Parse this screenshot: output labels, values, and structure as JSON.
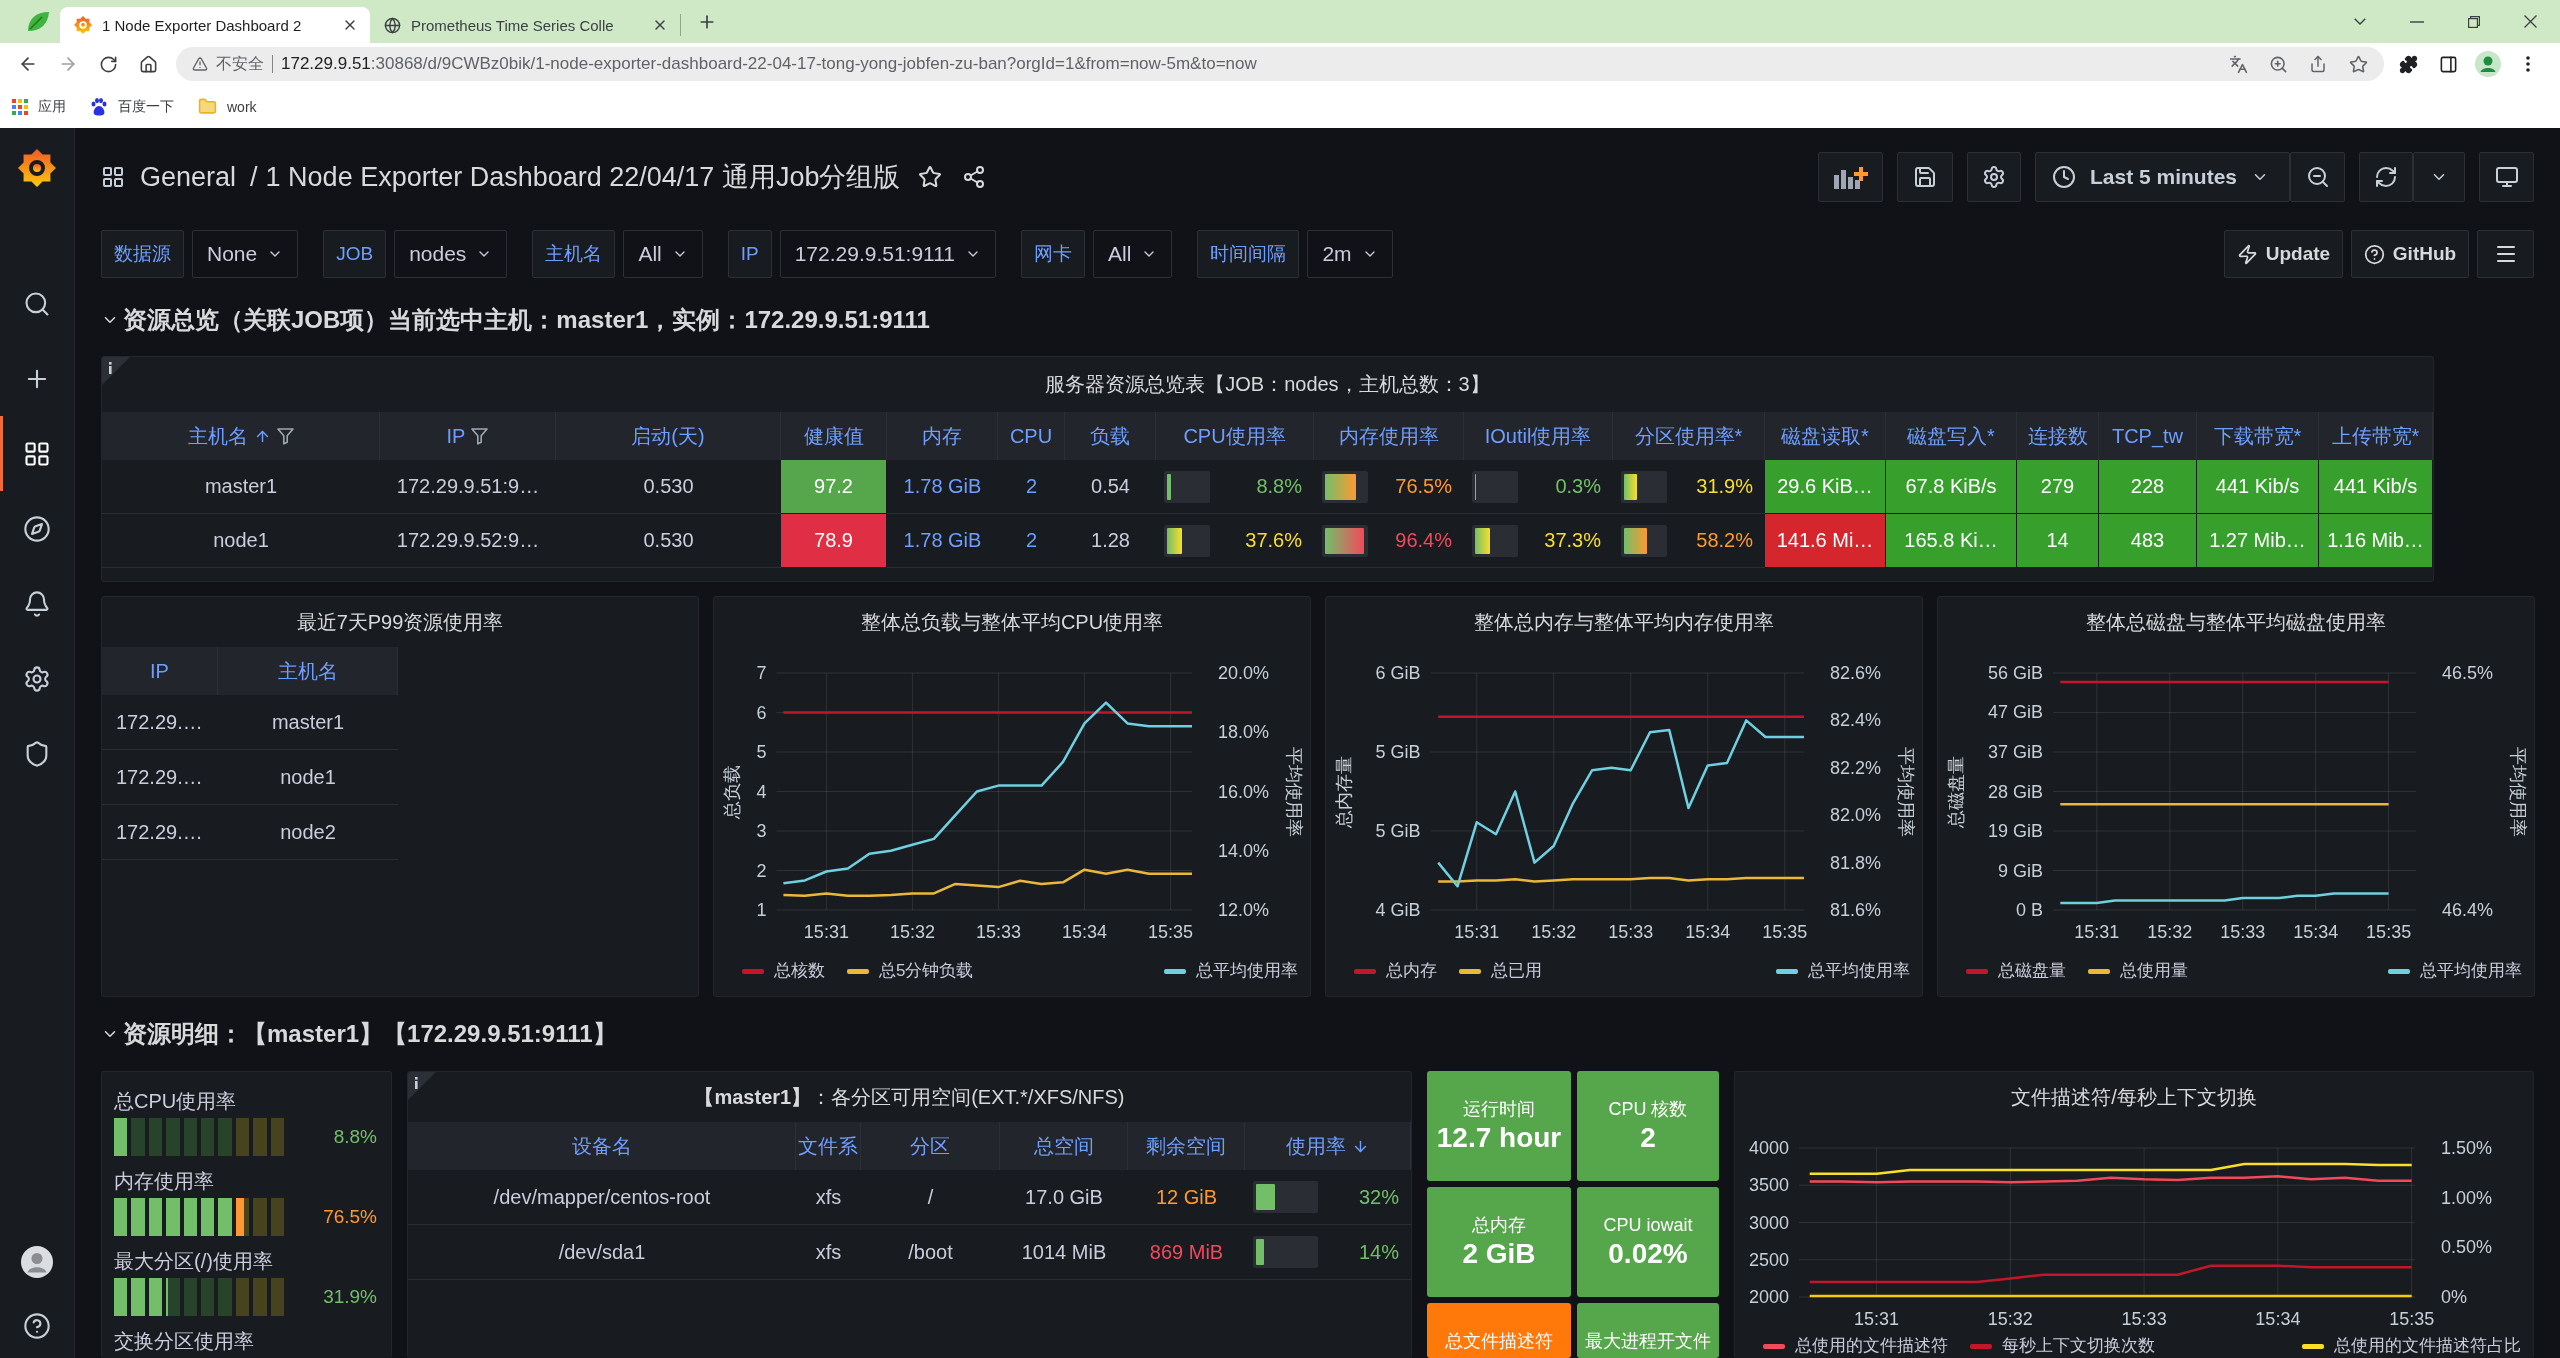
{
  "browser": {
    "tabs": [
      {
        "title": "1 Node Exporter Dashboard 2",
        "selected": true
      },
      {
        "title": "Prometheus Time Series Colle",
        "selected": false
      }
    ],
    "address": {
      "security": "不安全",
      "host": "172.29.9.51",
      "path": ":30868/d/9CWBz0bik/1-node-exporter-dashboard-22-04-17-tong-yong-jobfen-zu-ban?orgId=1&from=now-5m&to=now"
    },
    "bookmarks": [
      "应用",
      "百度一下",
      "work"
    ]
  },
  "sidebar": {
    "items": [
      {
        "selected": false
      },
      {
        "selected": false
      },
      {
        "selected": true
      },
      {
        "selected": false
      },
      {
        "selected": false
      },
      {
        "selected": false
      },
      {
        "selected": false
      }
    ]
  },
  "header": {
    "folder": "General",
    "separator": "/",
    "title": "1 Node Exporter Dashboard 22/04/17 通用Job分组版",
    "time_range": "Last 5 minutes"
  },
  "variables": [
    {
      "label": "数据源",
      "value": "None"
    },
    {
      "label": "JOB",
      "value": "nodes"
    },
    {
      "label": "主机名",
      "value": "All"
    },
    {
      "label": "IP",
      "value": "172.29.9.51:9111"
    },
    {
      "label": "网卡",
      "value": "All"
    },
    {
      "label": "时间间隔",
      "value": "2m"
    }
  ],
  "dashboard_links": [
    "Update",
    "GitHub"
  ],
  "overview_row": {
    "title": "资源总览（关联JOB项）当前选中主机：master1，实例：172.29.9.51:9111",
    "expanded": true
  },
  "server_table": {
    "title": "服务器资源总览表【JOB：nodes，主机总数：3】",
    "columns": [
      {
        "label": "主机名",
        "sorted_up": true,
        "sorted_down": false,
        "filterable": true
      },
      {
        "label": "IP",
        "sorted_up": false,
        "sorted_down": false,
        "filterable": true
      },
      {
        "label": "启动(天)",
        "sorted_up": false,
        "sorted_down": false,
        "filterable": false
      },
      {
        "label": "健康值",
        "sorted_up": false,
        "sorted_down": false,
        "filterable": false
      },
      {
        "label": "内存",
        "sorted_up": false,
        "sorted_down": false,
        "filterable": false
      },
      {
        "label": "CPU",
        "sorted_up": false,
        "sorted_down": false,
        "filterable": false
      },
      {
        "label": "负载",
        "sorted_up": false,
        "sorted_down": false,
        "filterable": false
      },
      {
        "label": "CPU使用率",
        "sorted_up": false,
        "sorted_down": false,
        "filterable": false
      },
      {
        "label": "内存使用率",
        "sorted_up": false,
        "sorted_down": false,
        "filterable": false
      },
      {
        "label": "IOutil使用率",
        "sorted_up": false,
        "sorted_down": false,
        "filterable": false
      },
      {
        "label": "分区使用率*",
        "sorted_up": false,
        "sorted_down": false,
        "filterable": false
      },
      {
        "label": "磁盘读取*",
        "sorted_up": false,
        "sorted_down": false,
        "filterable": false
      },
      {
        "label": "磁盘写入*",
        "sorted_up": false,
        "sorted_down": false,
        "filterable": false
      },
      {
        "label": "连接数",
        "sorted_up": false,
        "sorted_down": false,
        "filterable": false
      },
      {
        "label": "TCP_tw",
        "sorted_up": false,
        "sorted_down": false,
        "filterable": false
      },
      {
        "label": "下载带宽*",
        "sorted_up": false,
        "sorted_down": false,
        "filterable": false
      },
      {
        "label": "上传带宽*",
        "sorted_up": false,
        "sorted_down": false,
        "filterable": false
      }
    ],
    "rows": [
      [
        {
          "kind": "plain",
          "text": "master1"
        },
        {
          "kind": "plain",
          "text": "172.29.9.51:9…"
        },
        {
          "kind": "plain",
          "text": "0.530"
        },
        {
          "kind": "fill",
          "text": "97.2",
          "color": "#56a64b"
        },
        {
          "kind": "link",
          "text": "1.78 GiB"
        },
        {
          "kind": "link",
          "text": "2"
        },
        {
          "kind": "plain",
          "text": "0.54"
        },
        {
          "kind": "bar",
          "text": "8.8%",
          "level": 0.088,
          "color": "#73bf69"
        },
        {
          "kind": "bar",
          "text": "76.5%",
          "level": 0.765,
          "color": "#ff9830"
        },
        {
          "kind": "bar",
          "text": "0.3%",
          "level": 0.003,
          "color": "#73bf69"
        },
        {
          "kind": "bar",
          "text": "31.9%",
          "level": 0.319,
          "color": "#fade2a"
        },
        {
          "kind": "fill",
          "text": "29.6 KiB…",
          "color": "#37a02c"
        },
        {
          "kind": "fill",
          "text": "67.8 KiB/s",
          "color": "#37a02c"
        },
        {
          "kind": "fill",
          "text": "279",
          "color": "#37a02c"
        },
        {
          "kind": "fill",
          "text": "228",
          "color": "#37a02c"
        },
        {
          "kind": "fill",
          "text": "441 Kib/s",
          "color": "#37a02c"
        },
        {
          "kind": "fill",
          "text": "441 Kib/s",
          "color": "#37a02c"
        }
      ],
      [
        {
          "kind": "plain",
          "text": "node1"
        },
        {
          "kind": "plain",
          "text": "172.29.9.52:9…"
        },
        {
          "kind": "plain",
          "text": "0.530"
        },
        {
          "kind": "fill",
          "text": "78.9",
          "color": "#e02f44"
        },
        {
          "kind": "link",
          "text": "1.78 GiB"
        },
        {
          "kind": "link",
          "text": "2"
        },
        {
          "kind": "plain",
          "text": "1.28"
        },
        {
          "kind": "bar",
          "text": "37.6%",
          "level": 0.376,
          "color": "#fade2a"
        },
        {
          "kind": "bar",
          "text": "96.4%",
          "level": 0.964,
          "color": "#f2495c"
        },
        {
          "kind": "bar",
          "text": "37.3%",
          "level": 0.373,
          "color": "#fade2a"
        },
        {
          "kind": "bar",
          "text": "58.2%",
          "level": 0.582,
          "color": "#ff9830"
        },
        {
          "kind": "fill",
          "text": "141.6 Mi…",
          "color": "#d4262c"
        },
        {
          "kind": "fill",
          "text": "165.8 Ki…",
          "color": "#37a02c"
        },
        {
          "kind": "fill",
          "text": "14",
          "color": "#37a02c"
        },
        {
          "kind": "fill",
          "text": "483",
          "color": "#37a02c"
        },
        {
          "kind": "fill",
          "text": "1.27 Mib…",
          "color": "#37a02c"
        },
        {
          "kind": "fill",
          "text": "1.16 Mib…",
          "color": "#37a02c"
        }
      ]
    ]
  },
  "p99_table": {
    "title": "最近7天P99资源使用率",
    "columns": [
      "IP",
      "主机名"
    ],
    "rows": [
      [
        "172.29.…",
        "master1"
      ],
      [
        "172.29.…",
        "node1"
      ],
      [
        "172.29.…",
        "node2"
      ]
    ]
  },
  "charts": [
    {
      "chart_data": {
        "type": "line",
        "title": "整体总负载与整体平均CPU使用率",
        "ylabel": "总负载",
        "y2label": "平均使用率",
        "grid": true,
        "legend": "bottom",
        "categories": [
          null,
          null,
          "15:31",
          null,
          null,
          null,
          "15:32",
          null,
          null,
          null,
          "15:33",
          null,
          null,
          null,
          "15:34",
          null,
          null,
          null,
          "15:35",
          null
        ],
        "ylim": [
          1,
          7
        ],
        "y2lim": [
          12,
          20
        ],
        "yticks": [
          1,
          2,
          3,
          4,
          5,
          6,
          7
        ],
        "y2ticks": [
          {
            "value": 12,
            "label": "12.0%"
          },
          {
            "value": 14,
            "label": "14.0%"
          },
          {
            "value": 16,
            "label": "16.0%"
          },
          {
            "value": 18,
            "label": "18.0%"
          },
          {
            "value": 20,
            "label": "20.0%"
          }
        ],
        "series": [
          {
            "name": "总核数",
            "color": "#c4162a",
            "values": [
              6,
              6,
              6,
              6,
              6,
              6,
              6,
              6,
              6,
              6,
              6,
              6,
              6,
              6,
              6,
              6,
              6,
              6,
              6,
              6
            ]
          },
          {
            "name": "总5分钟负载",
            "color": "#eab839",
            "values": [
              1.38,
              1.36,
              1.42,
              1.36,
              1.36,
              1.38,
              1.42,
              1.42,
              1.66,
              1.62,
              1.58,
              1.74,
              1.66,
              1.7,
              2.02,
              1.92,
              2.02,
              1.92,
              1.92,
              1.92
            ]
          },
          {
            "name": "总平均使用率",
            "color": "#6ed0e0",
            "axis": "y2",
            "values": [
              12.9,
              13.0,
              13.3,
              13.4,
              13.9,
              14.0,
              14.2,
              14.4,
              15.2,
              16.0,
              16.2,
              16.2,
              16.2,
              17.0,
              18.3,
              19.0,
              18.3,
              18.2,
              18.2,
              18.2
            ]
          }
        ]
      }
    },
    {
      "chart_data": {
        "type": "line",
        "title": "整体总内存与整体平均内存使用率",
        "ylabel": "总内存量",
        "y2label": "平均使用率",
        "grid": true,
        "legend": "bottom",
        "categories": [
          null,
          null,
          "15:31",
          null,
          null,
          null,
          "15:32",
          null,
          null,
          null,
          "15:33",
          null,
          null,
          null,
          "15:34",
          null,
          null,
          null,
          "15:35",
          null
        ],
        "ylim": [
          4,
          6
        ],
        "y2lim": [
          81.6,
          82.6
        ],
        "yticks": [
          {
            "value": 4,
            "label": "4 GiB"
          },
          {
            "value": 4.667,
            "label": "5 GiB"
          },
          {
            "value": 5.333,
            "label": "5 GiB"
          },
          {
            "value": 6,
            "label": "6 GiB"
          }
        ],
        "y2ticks": [
          {
            "value": 81.6,
            "label": "81.6%"
          },
          {
            "value": 81.8,
            "label": "81.8%"
          },
          {
            "value": 82,
            "label": "82.0%"
          },
          {
            "value": 82.2,
            "label": "82.2%"
          },
          {
            "value": 82.4,
            "label": "82.4%"
          },
          {
            "value": 82.6,
            "label": "82.6%"
          }
        ],
        "series": [
          {
            "name": "总内存",
            "color": "#c4162a",
            "values": [
              5.63,
              5.63,
              5.63,
              5.63,
              5.63,
              5.63,
              5.63,
              5.63,
              5.63,
              5.63,
              5.63,
              5.63,
              5.63,
              5.63,
              5.63,
              5.63,
              5.63,
              5.63,
              5.63,
              5.63
            ]
          },
          {
            "name": "总已用",
            "color": "#eab839",
            "values": [
              4.24,
              4.24,
              4.25,
              4.25,
              4.26,
              4.24,
              4.25,
              4.26,
              4.26,
              4.26,
              4.26,
              4.27,
              4.27,
              4.25,
              4.26,
              4.26,
              4.27,
              4.27,
              4.27,
              4.27
            ]
          },
          {
            "name": "总平均使用率",
            "color": "#6ed0e0",
            "axis": "y2",
            "values": [
              81.8,
              81.7,
              81.97,
              81.92,
              82.1,
              81.8,
              81.87,
              82.05,
              82.19,
              82.2,
              82.19,
              82.35,
              82.36,
              82.03,
              82.21,
              82.22,
              82.4,
              82.33,
              82.33,
              82.33
            ]
          }
        ]
      }
    },
    {
      "chart_data": {
        "type": "line",
        "title": "整体总磁盘与整体平均磁盘使用率",
        "ylabel": "总磁盘量",
        "y2label": "平均使用率",
        "grid": true,
        "legend": "bottom",
        "categories": [
          null,
          null,
          "15:31",
          null,
          null,
          null,
          "15:32",
          null,
          null,
          null,
          "15:33",
          null,
          null,
          null,
          "15:34",
          null,
          null,
          null,
          "15:35"
        ],
        "ylim": [
          0,
          56
        ],
        "y2lim": [
          46.4,
          46.5
        ],
        "yticks": [
          {
            "value": 0,
            "label": "0 B"
          },
          {
            "value": 9.33,
            "label": "9 GiB"
          },
          {
            "value": 18.67,
            "label": "19 GiB"
          },
          {
            "value": 28,
            "label": "28 GiB"
          },
          {
            "value": 37.33,
            "label": "37 GiB"
          },
          {
            "value": 46.67,
            "label": "47 GiB"
          },
          {
            "value": 56,
            "label": "56 GiB"
          }
        ],
        "y2ticks": [
          {
            "value": 46.4,
            "label": "46.4%"
          },
          {
            "value": 46.5,
            "label": "46.5%"
          }
        ],
        "series": [
          {
            "name": "总磁盘量",
            "color": "#c4162a",
            "values": [
              53.9,
              53.9,
              53.9,
              53.9,
              53.9,
              53.9,
              53.9,
              53.9,
              53.9,
              53.9,
              53.9,
              53.9,
              53.9,
              53.9,
              53.9,
              53.9,
              53.9,
              53.9,
              53.9
            ]
          },
          {
            "name": "总使用量",
            "color": "#eab839",
            "values": [
              25,
              25,
              25,
              25,
              25,
              25,
              25,
              25,
              25,
              25,
              25,
              25,
              25,
              25,
              25,
              25,
              25,
              25,
              25
            ]
          },
          {
            "name": "总平均使用率",
            "color": "#6ed0e0",
            "axis": "y2",
            "values": [
              46.403,
              46.403,
              46.403,
              46.404,
              46.404,
              46.404,
              46.404,
              46.404,
              46.404,
              46.404,
              46.405,
              46.405,
              46.405,
              46.406,
              46.406,
              46.407,
              46.407,
              46.407,
              46.407
            ]
          }
        ]
      }
    }
  ],
  "detail_row": {
    "title": "资源明细：【master1】【172.29.9.51:9111】",
    "expanded": true
  },
  "gauges": [
    {
      "label": "总CPU使用率",
      "value": "8.8%",
      "level": 0.088,
      "color": "#73bf69"
    },
    {
      "label": "内存使用率",
      "value": "76.5%",
      "level": 0.765,
      "color": "#ff9830"
    },
    {
      "label": "最大分区(/)使用率",
      "value": "31.9%",
      "level": 0.319,
      "color": "#73bf69"
    },
    {
      "label": "交换分区使用率"
    }
  ],
  "partition_table": {
    "title": "**【master1】**：各分区可用空间(EXT.*/XFS/NFS)",
    "columns": [
      {
        "label": "设备名",
        "sorted_up": false,
        "sorted_down": false
      },
      {
        "label": "文件系",
        "sorted_up": false,
        "sorted_down": false
      },
      {
        "label": "分区",
        "sorted_up": false,
        "sorted_down": false
      },
      {
        "label": "总空间",
        "sorted_up": false,
        "sorted_down": false
      },
      {
        "label": "剩余空间",
        "sorted_up": false,
        "sorted_down": false
      },
      {
        "label": "使用率",
        "sorted_up": false,
        "sorted_down": true
      }
    ],
    "rows": [
      [
        {
          "kind": "plain",
          "text": "/dev/mapper/centos-root"
        },
        {
          "kind": "plain",
          "text": "xfs"
        },
        {
          "kind": "plain",
          "text": "/"
        },
        {
          "kind": "plain",
          "text": "17.0 GiB"
        },
        {
          "kind": "colored",
          "text": "12 GiB",
          "color": "#ff9830"
        },
        {
          "kind": "bar",
          "text": "32%",
          "level": 0.32,
          "color": "#73bf69"
        }
      ],
      [
        {
          "kind": "plain",
          "text": "/dev/sda1"
        },
        {
          "kind": "plain",
          "text": "xfs"
        },
        {
          "kind": "plain",
          "text": "/boot"
        },
        {
          "kind": "plain",
          "text": "1014 MiB"
        },
        {
          "kind": "colored",
          "text": "869 MiB",
          "color": "#f2495c"
        },
        {
          "kind": "bar",
          "text": "14%",
          "level": 0.14,
          "color": "#73bf69"
        }
      ]
    ]
  },
  "stats": [
    {
      "title": "运行时间",
      "value": "12.7 hour",
      "color": "#56a64b"
    },
    {
      "title": "CPU 核数",
      "value": "2",
      "color": "#56a64b"
    },
    {
      "title": "总内存",
      "value": "2 GiB",
      "color": "#56a64b"
    },
    {
      "title": "CPU iowait",
      "value": "0.02%",
      "color": "#56a64b"
    },
    {
      "title": "总文件描述符",
      "color": "#ff780a"
    },
    {
      "title": "最大进程开文件",
      "color": "#56a64b"
    }
  ],
  "fd_chart": {
    "chart_data": {
      "type": "line",
      "title": "文件描述符/每秒上下文切换",
      "grid": true,
      "legend": "bottom",
      "categories": [
        null,
        null,
        "15:31",
        null,
        null,
        null,
        "15:32",
        null,
        null,
        null,
        "15:33",
        null,
        null,
        null,
        "15:34",
        null,
        null,
        null,
        "15:35"
      ],
      "ylim": [
        2000,
        4000
      ],
      "y2lim": [
        0,
        1.5
      ],
      "yticks": [
        2000,
        2500,
        3000,
        3500,
        4000
      ],
      "y2ticks": [
        {
          "value": 0,
          "label": "0%"
        },
        {
          "value": 0.5,
          "label": "0.50%"
        },
        {
          "value": 1,
          "label": "1.00%"
        },
        {
          "value": 1.5,
          "label": "1.50%"
        }
      ],
      "series": [
        {
          "name": "总使用的文件描述符",
          "color": "#f2495c",
          "values": [
            3550,
            3550,
            3540,
            3550,
            3550,
            3550,
            3540,
            3550,
            3560,
            3600,
            3580,
            3570,
            3600,
            3600,
            3620,
            3580,
            3600,
            3560,
            3560
          ]
        },
        {
          "name": "每秒上下文切换次数",
          "color": "#c4162a",
          "values": [
            2200,
            2200,
            2200,
            2200,
            2200,
            2200,
            2250,
            2300,
            2300,
            2300,
            2300,
            2300,
            2420,
            2420,
            2420,
            2400,
            2400,
            2400,
            2400
          ]
        },
        {
          "name": "总使用的文件描述符占比",
          "color": "#fade2a",
          "axis": "y2",
          "values": [
            1.24,
            1.24,
            1.24,
            1.28,
            1.28,
            1.28,
            1.28,
            1.28,
            1.28,
            1.28,
            1.28,
            1.28,
            1.28,
            1.34,
            1.34,
            1.34,
            1.34,
            1.33,
            1.33
          ]
        },
        {
          "color": "#f2cc0c",
          "axis": "y2",
          "values": [
            0.01,
            0.01,
            0.01,
            0.01,
            0.01,
            0.01,
            0.01,
            0.01,
            0.01,
            0.01,
            0.01,
            0.01,
            0.01,
            0.01,
            0.01,
            0.01,
            0.01,
            0.01,
            0.01
          ]
        }
      ]
    }
  }
}
